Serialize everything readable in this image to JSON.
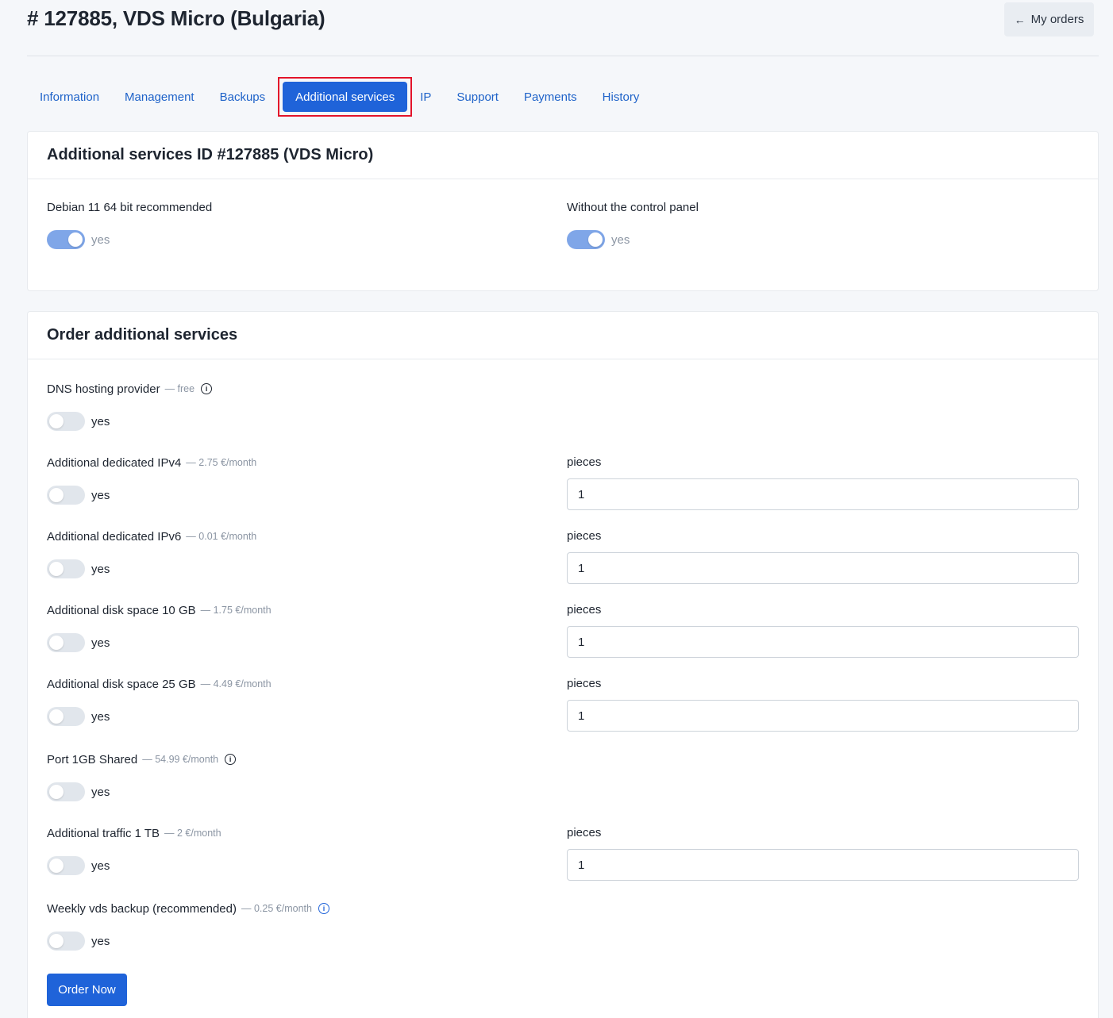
{
  "header": {
    "title": "# 127885, VDS Micro (Bulgaria)",
    "my_orders_label": "My orders",
    "my_orders_icon": "arrow-left-icon"
  },
  "tabs": [
    {
      "label": "Information",
      "active": false
    },
    {
      "label": "Management",
      "active": false
    },
    {
      "label": "Backups",
      "active": false
    },
    {
      "label": "Additional services",
      "active": true
    },
    {
      "label": "IP",
      "active": false
    },
    {
      "label": "Support",
      "active": false
    },
    {
      "label": "Payments",
      "active": false
    },
    {
      "label": "History",
      "active": false
    }
  ],
  "current_services": {
    "title": "Additional services ID #127885 (VDS Micro)",
    "items": [
      {
        "label": "Debian 11 64 bit recommended",
        "toggle_text": "yes",
        "enabled": true
      },
      {
        "label": "Without the control panel",
        "toggle_text": "yes",
        "enabled": true
      }
    ]
  },
  "order_services": {
    "title": "Order additional services",
    "pieces_label": "pieces",
    "items": [
      {
        "label": "DNS hosting provider",
        "price": "— free",
        "info_icon": true,
        "toggle_text": "yes",
        "enabled": false,
        "has_pieces": false
      },
      {
        "label": "Additional dedicated IPv4",
        "price": "— 2.75 €/month",
        "info_icon": false,
        "toggle_text": "yes",
        "enabled": false,
        "has_pieces": true,
        "pieces_value": "1"
      },
      {
        "label": "Additional dedicated IPv6",
        "price": "— 0.01 €/month",
        "info_icon": false,
        "toggle_text": "yes",
        "enabled": false,
        "has_pieces": true,
        "pieces_value": "1"
      },
      {
        "label": "Additional disk space 10 GB",
        "price": "— 1.75 €/month",
        "info_icon": false,
        "toggle_text": "yes",
        "enabled": false,
        "has_pieces": true,
        "pieces_value": "1"
      },
      {
        "label": "Additional disk space 25 GB",
        "price": "— 4.49 €/month",
        "info_icon": false,
        "toggle_text": "yes",
        "enabled": false,
        "has_pieces": true,
        "pieces_value": "1"
      },
      {
        "label": "Port 1GB Shared",
        "price": "— 54.99 €/month",
        "info_icon": true,
        "toggle_text": "yes",
        "enabled": false,
        "has_pieces": false
      },
      {
        "label": "Additional traffic 1 TB",
        "price": "— 2 €/month",
        "info_icon": false,
        "toggle_text": "yes",
        "enabled": false,
        "has_pieces": true,
        "pieces_value": "1"
      },
      {
        "label": "Weekly vds backup (recommended)",
        "price": "— 0.25 €/month",
        "info_icon": true,
        "info_icon_color": "#1f63d9",
        "toggle_text": "yes",
        "enabled": false,
        "has_pieces": false
      }
    ],
    "order_button_label": "Order Now"
  },
  "colors": {
    "accent": "#1f63d9",
    "link": "#1f63c9",
    "highlight_border": "#e3142a",
    "toggle_on": "#7fa6e8",
    "toggle_off": "#e1e6ec"
  }
}
